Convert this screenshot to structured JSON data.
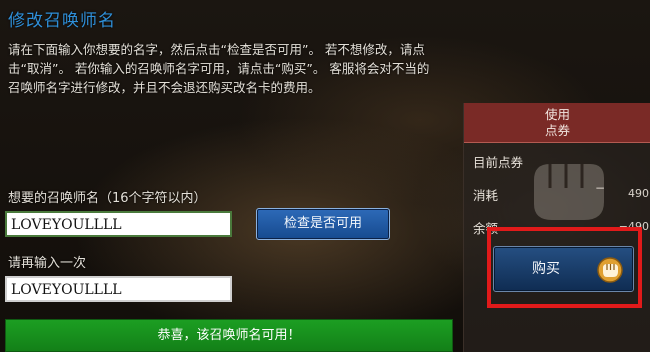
{
  "title": "修改召唤师名",
  "instructions": "请在下面输入你想要的名字，然后点击“检查是否可用”。 若不想修改，请点击“取消”。 若你输入的召唤师名字可用，请点击“购买”。 客服将会对不当的召唤师名字进行修改，并且不会退还购买改名卡的费用。",
  "form": {
    "desired_label": "想要的召唤师名（16个字符以内）",
    "name_value": "LOVEYOULLLL",
    "check_button": "检查是否可用",
    "repeat_label": "请再输入一次",
    "repeat_value": "LOVEYOULLLL",
    "success_message": "恭喜，该召唤师名可用！"
  },
  "panel": {
    "header_line1": "使用",
    "header_line2": "点券",
    "current_label": "目前点券",
    "consume_label": "消耗",
    "consume_sign": "−",
    "consume_value": "490",
    "remain_label": "余额",
    "remain_value": "−490",
    "buy_button": "购买"
  },
  "colors": {
    "title": "#2f8fd8",
    "success_bar": "#1c9e22",
    "panel_header": "#7a2a26",
    "highlight_frame": "#e11a1a",
    "check_button": "#2d6ab8"
  },
  "icons": {
    "buy": "fist-coin-icon",
    "panel_watermark": "fist-watermark-icon"
  }
}
